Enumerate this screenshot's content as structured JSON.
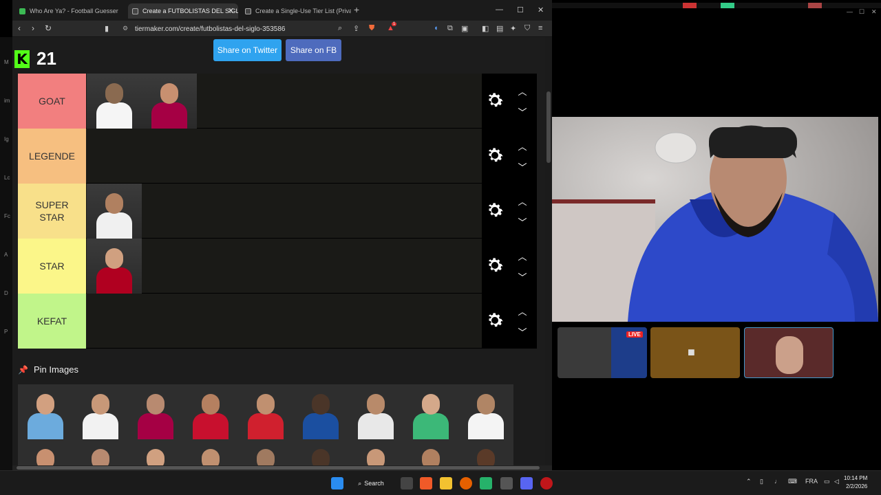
{
  "browser": {
    "tabs": [
      {
        "label": "Who Are Ya? - Football Guesser",
        "active": false
      },
      {
        "label": "Create a FUTBOLISTAS DEL SIGLO",
        "active": true
      },
      {
        "label": "Create a Single-Use Tier List (Private",
        "active": false
      }
    ],
    "url": "tiermaker.com/create/futbolistas-del-siglo-353586",
    "shield_badge": "1"
  },
  "kick": {
    "logo": "K",
    "count": "21"
  },
  "share": {
    "twitter": "Share on Twitter",
    "fb": "Share on FB"
  },
  "tiers": [
    {
      "label": "GOAT",
      "color": "#f27f7f",
      "images": [
        "player-1",
        "player-2"
      ]
    },
    {
      "label": "LEGENDE",
      "color": "#f6bf80",
      "images": []
    },
    {
      "label": "SUPER\nSTAR",
      "color": "#f8e08a",
      "images": [
        "player-3"
      ]
    },
    {
      "label": "STAR",
      "color": "#fbf689",
      "images": [
        "player-4"
      ]
    },
    {
      "label": "KEFAT",
      "color": "#c1f58a",
      "images": []
    }
  ],
  "pin_images": {
    "title": "Pin Images",
    "count": 18
  },
  "stream": {
    "live_badge": "LIVE"
  },
  "taskbar": {
    "search_label": "Search",
    "language": "FRA",
    "time": "10:14 PM",
    "date": "2/2/2026"
  },
  "left_strip_letters": [
    "M",
    "im",
    "Ig",
    "Lc",
    "Fc",
    "A",
    "D",
    "P"
  ]
}
